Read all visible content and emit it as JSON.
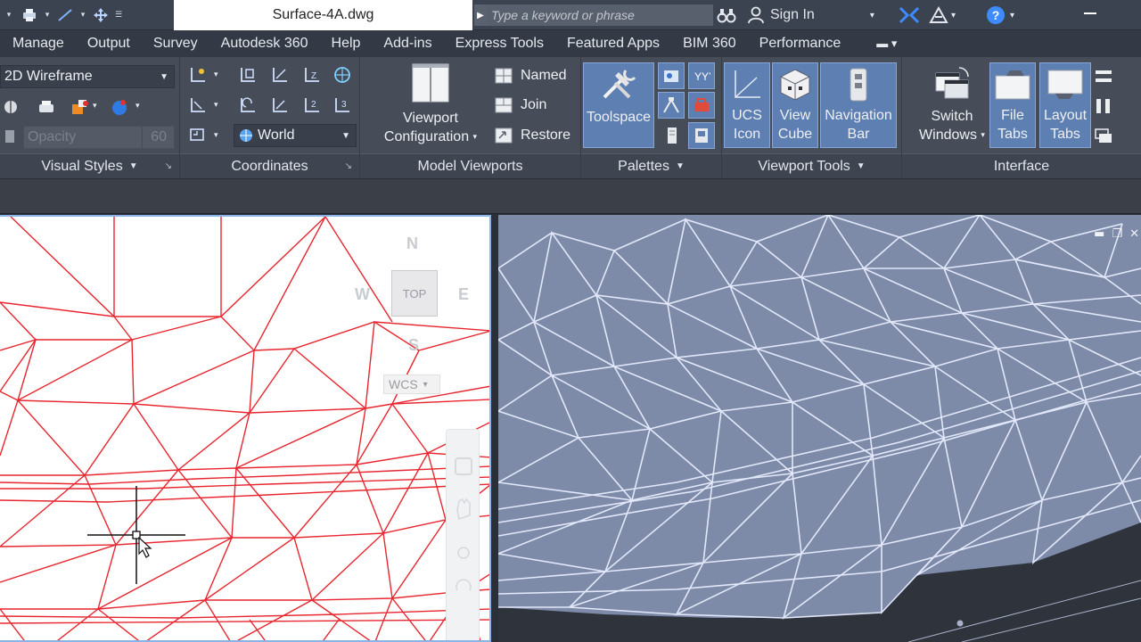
{
  "titlebar": {
    "document_title": "Surface-4A.dwg",
    "search_placeholder": "Type a keyword or phrase",
    "sign_in_label": "Sign In"
  },
  "menu_tabs": [
    "Manage",
    "Output",
    "Survey",
    "Autodesk 360",
    "Help",
    "Add-ins",
    "Express Tools",
    "Featured Apps",
    "BIM 360",
    "Performance"
  ],
  "ribbon": {
    "visual_styles": {
      "title": "Visual Styles",
      "style_value": "2D Wireframe",
      "opacity_label": "Opacity",
      "opacity_value": "60"
    },
    "coordinates": {
      "title": "Coordinates",
      "ucs_value": "World"
    },
    "model_viewports": {
      "title": "Model Viewports",
      "viewport_config_line1": "Viewport",
      "viewport_config_line2": "Configuration",
      "named_label": "Named",
      "join_label": "Join",
      "restore_label": "Restore"
    },
    "palettes": {
      "title": "Palettes",
      "toolspace_label": "Toolspace"
    },
    "viewport_tools": {
      "title": "Viewport Tools",
      "ucs_icon_line1": "UCS",
      "ucs_icon_line2": "Icon",
      "view_cube_line1": "View",
      "view_cube_line2": "Cube",
      "nav_bar_line1": "Navigation",
      "nav_bar_line2": "Bar"
    },
    "interface": {
      "title": "Interface",
      "switch_windows_line1": "Switch",
      "switch_windows_line2": "Windows",
      "file_tabs_line1": "File",
      "file_tabs_line2": "Tabs",
      "layout_tabs_line1": "Layout",
      "layout_tabs_line2": "Tabs"
    }
  },
  "viewcube": {
    "north": "N",
    "west": "W",
    "east": "E",
    "south": "S",
    "face": "TOP",
    "ucs_menu": "WCS"
  },
  "colors": {
    "ribbon_bg": "#464d59",
    "active_button": "#5d7fb2",
    "mesh_red": "#e8262f",
    "mesh_3d_line": "#e8eeff",
    "viewport_3d_bg": "#7d8aa8"
  }
}
